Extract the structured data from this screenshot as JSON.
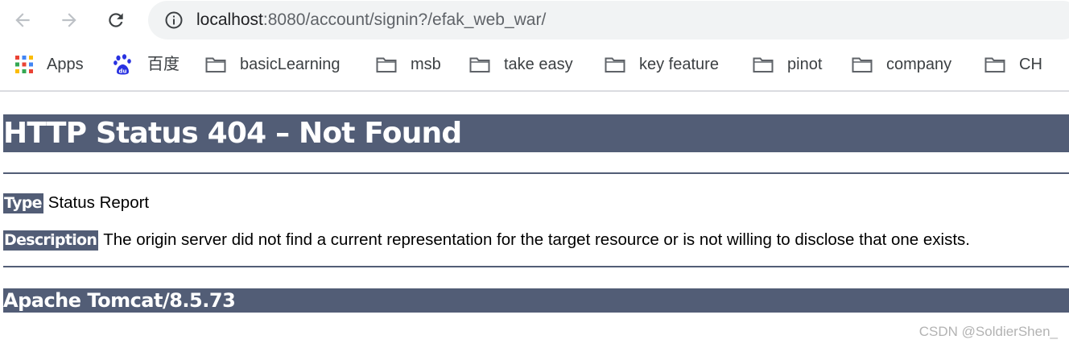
{
  "browser": {
    "url_host": "localhost",
    "url_rest": ":8080/account/signin?/efak_web_war/",
    "back_icon": "arrow-left-icon",
    "forward_icon": "arrow-right-icon",
    "reload_icon": "reload-icon",
    "info_icon": "info-icon"
  },
  "bookmarks": {
    "apps_label": "Apps",
    "baidu_label": "百度",
    "folders": [
      "basicLearning",
      "msb",
      "take easy",
      "key feature",
      "pinot",
      "company",
      "CH"
    ]
  },
  "error_page": {
    "title": "HTTP Status 404 – Not Found",
    "type_label": "Type",
    "type_value": "Status Report",
    "description_label": "Description",
    "description_value": "The origin server did not find a current representation for the target resource or is not willing to disclose that one exists.",
    "server_info": "Apache Tomcat/8.5.73"
  },
  "watermark": "CSDN @SoldierShen_",
  "colors": {
    "tomcat_bar": "#525d76",
    "omnibox_bg": "#f1f3f4",
    "url_host": "#202124",
    "url_path": "#5f6368"
  }
}
